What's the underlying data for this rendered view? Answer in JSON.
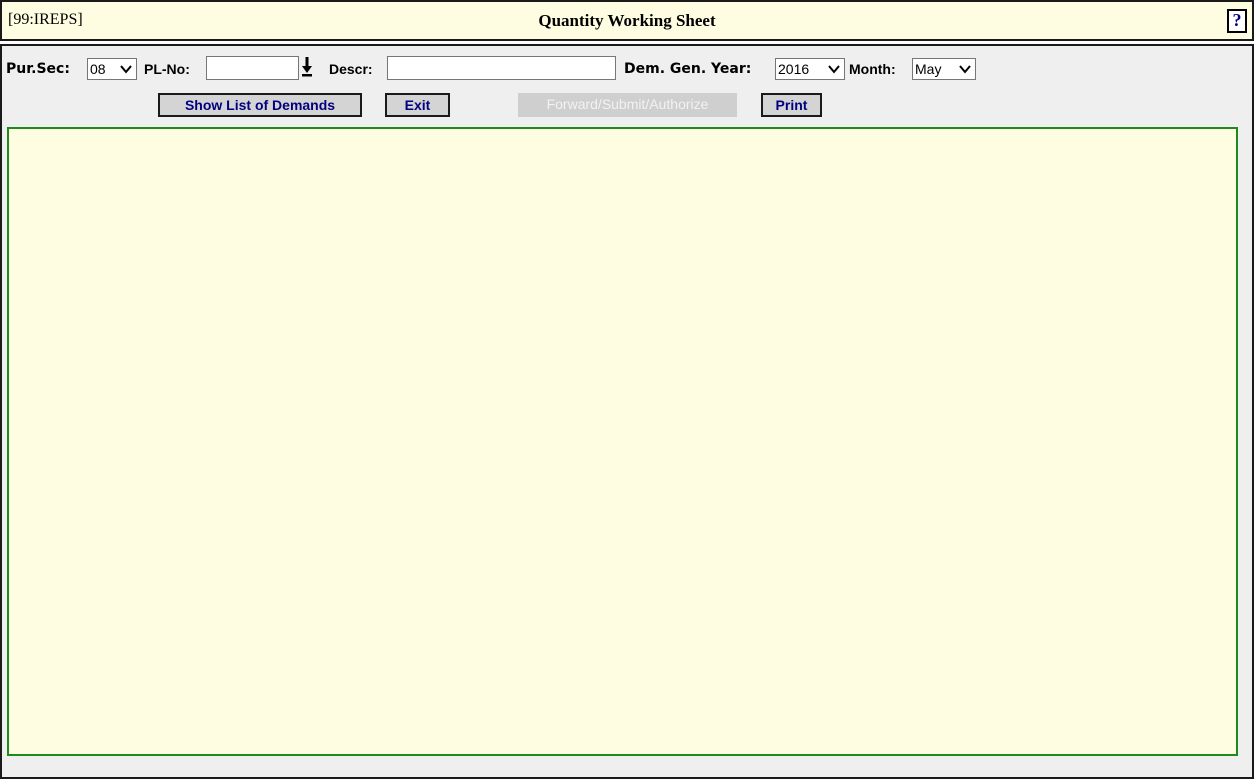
{
  "header": {
    "code": "[99:IREPS]",
    "title": "Quantity Working Sheet",
    "help_label": "?"
  },
  "filters": {
    "pur_sec_label": "Pur.Sec:",
    "pur_sec_value": "08",
    "pl_no_label": "PL-No:",
    "pl_no_value": "",
    "descr_label": "Descr:",
    "descr_value": "",
    "dem_gen_year_label": "Dem. Gen. Year:",
    "dem_gen_year_value": "2016",
    "month_label": "Month:",
    "month_value": "May"
  },
  "buttons": {
    "show_list": "Show List of Demands",
    "exit": "Exit",
    "forward": "Forward/Submit/Authorize",
    "print": "Print"
  },
  "colors": {
    "header_bg": "#fffde1",
    "panel_bg": "#efefef",
    "content_border": "#1e8a1e",
    "button_text": "#000080"
  },
  "icons": {
    "dropdown": "chevron-down-icon",
    "pl_lookup": "down-arrow-icon",
    "help": "help-icon"
  }
}
